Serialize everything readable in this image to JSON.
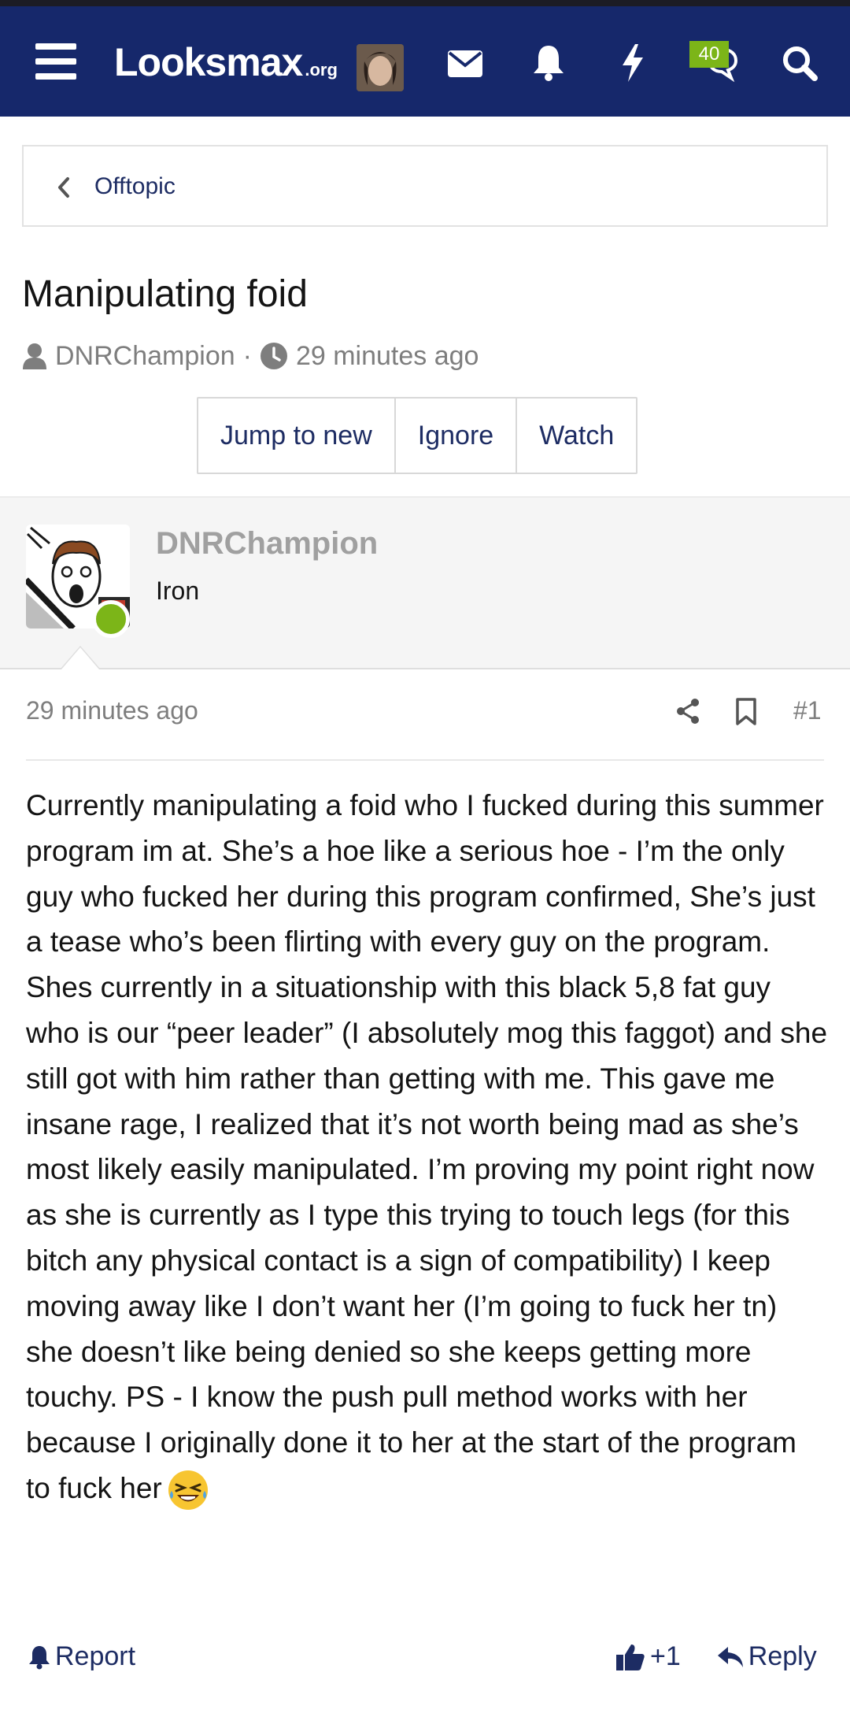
{
  "header": {
    "logo_main": "Looksmax",
    "logo_tld": ".org",
    "alerts_badge": "40",
    "colors": {
      "navbar": "#16286b",
      "badge": "#7cb518",
      "link": "#1d2c63"
    },
    "icons": [
      "menu-icon",
      "envelope-icon",
      "bell-icon",
      "bolt-icon",
      "chat-icon",
      "search-icon"
    ]
  },
  "breadcrumb": {
    "label": "Offtopic"
  },
  "thread": {
    "title": "Manipulating foid",
    "author": "DNRChampion",
    "separator": "·",
    "time": "29 minutes ago",
    "buttons": {
      "jump": "Jump to new",
      "ignore": "Ignore",
      "watch": "Watch"
    }
  },
  "post": {
    "username": "DNRChampion",
    "user_title": "Iron",
    "time": "29 minutes ago",
    "number": "#1",
    "body": "Currently manipulating a foid who I fucked during this summer program im at. She’s a hoe like a serious hoe - I’m the only guy who fucked her during this program confirmed, She’s just a tease who’s been flirting with every guy on the program. Shes currently in a situationship with this black 5,8 fat guy who is our “peer leader” (I absolutely mog this faggot) and she still got with him rather than getting with me. This gave me insane rage, I realized that it’s not worth being mad as she’s most likely easily manipulated. I’m proving my point right now as she is currently as I type this trying to touch legs (for this bitch any physical contact is a sign of compatibility) I keep moving away like I don’t want her (I’m going to fuck her tn) she doesn’t like being denied so she keeps getting more touchy. PS - I know the push pull method works with her because I originally done it to her at the start of the program to fuck her",
    "emoji": "laughing-with-tears-emoji"
  },
  "footer": {
    "report": "Report",
    "like": "+1",
    "reply": "Reply"
  }
}
